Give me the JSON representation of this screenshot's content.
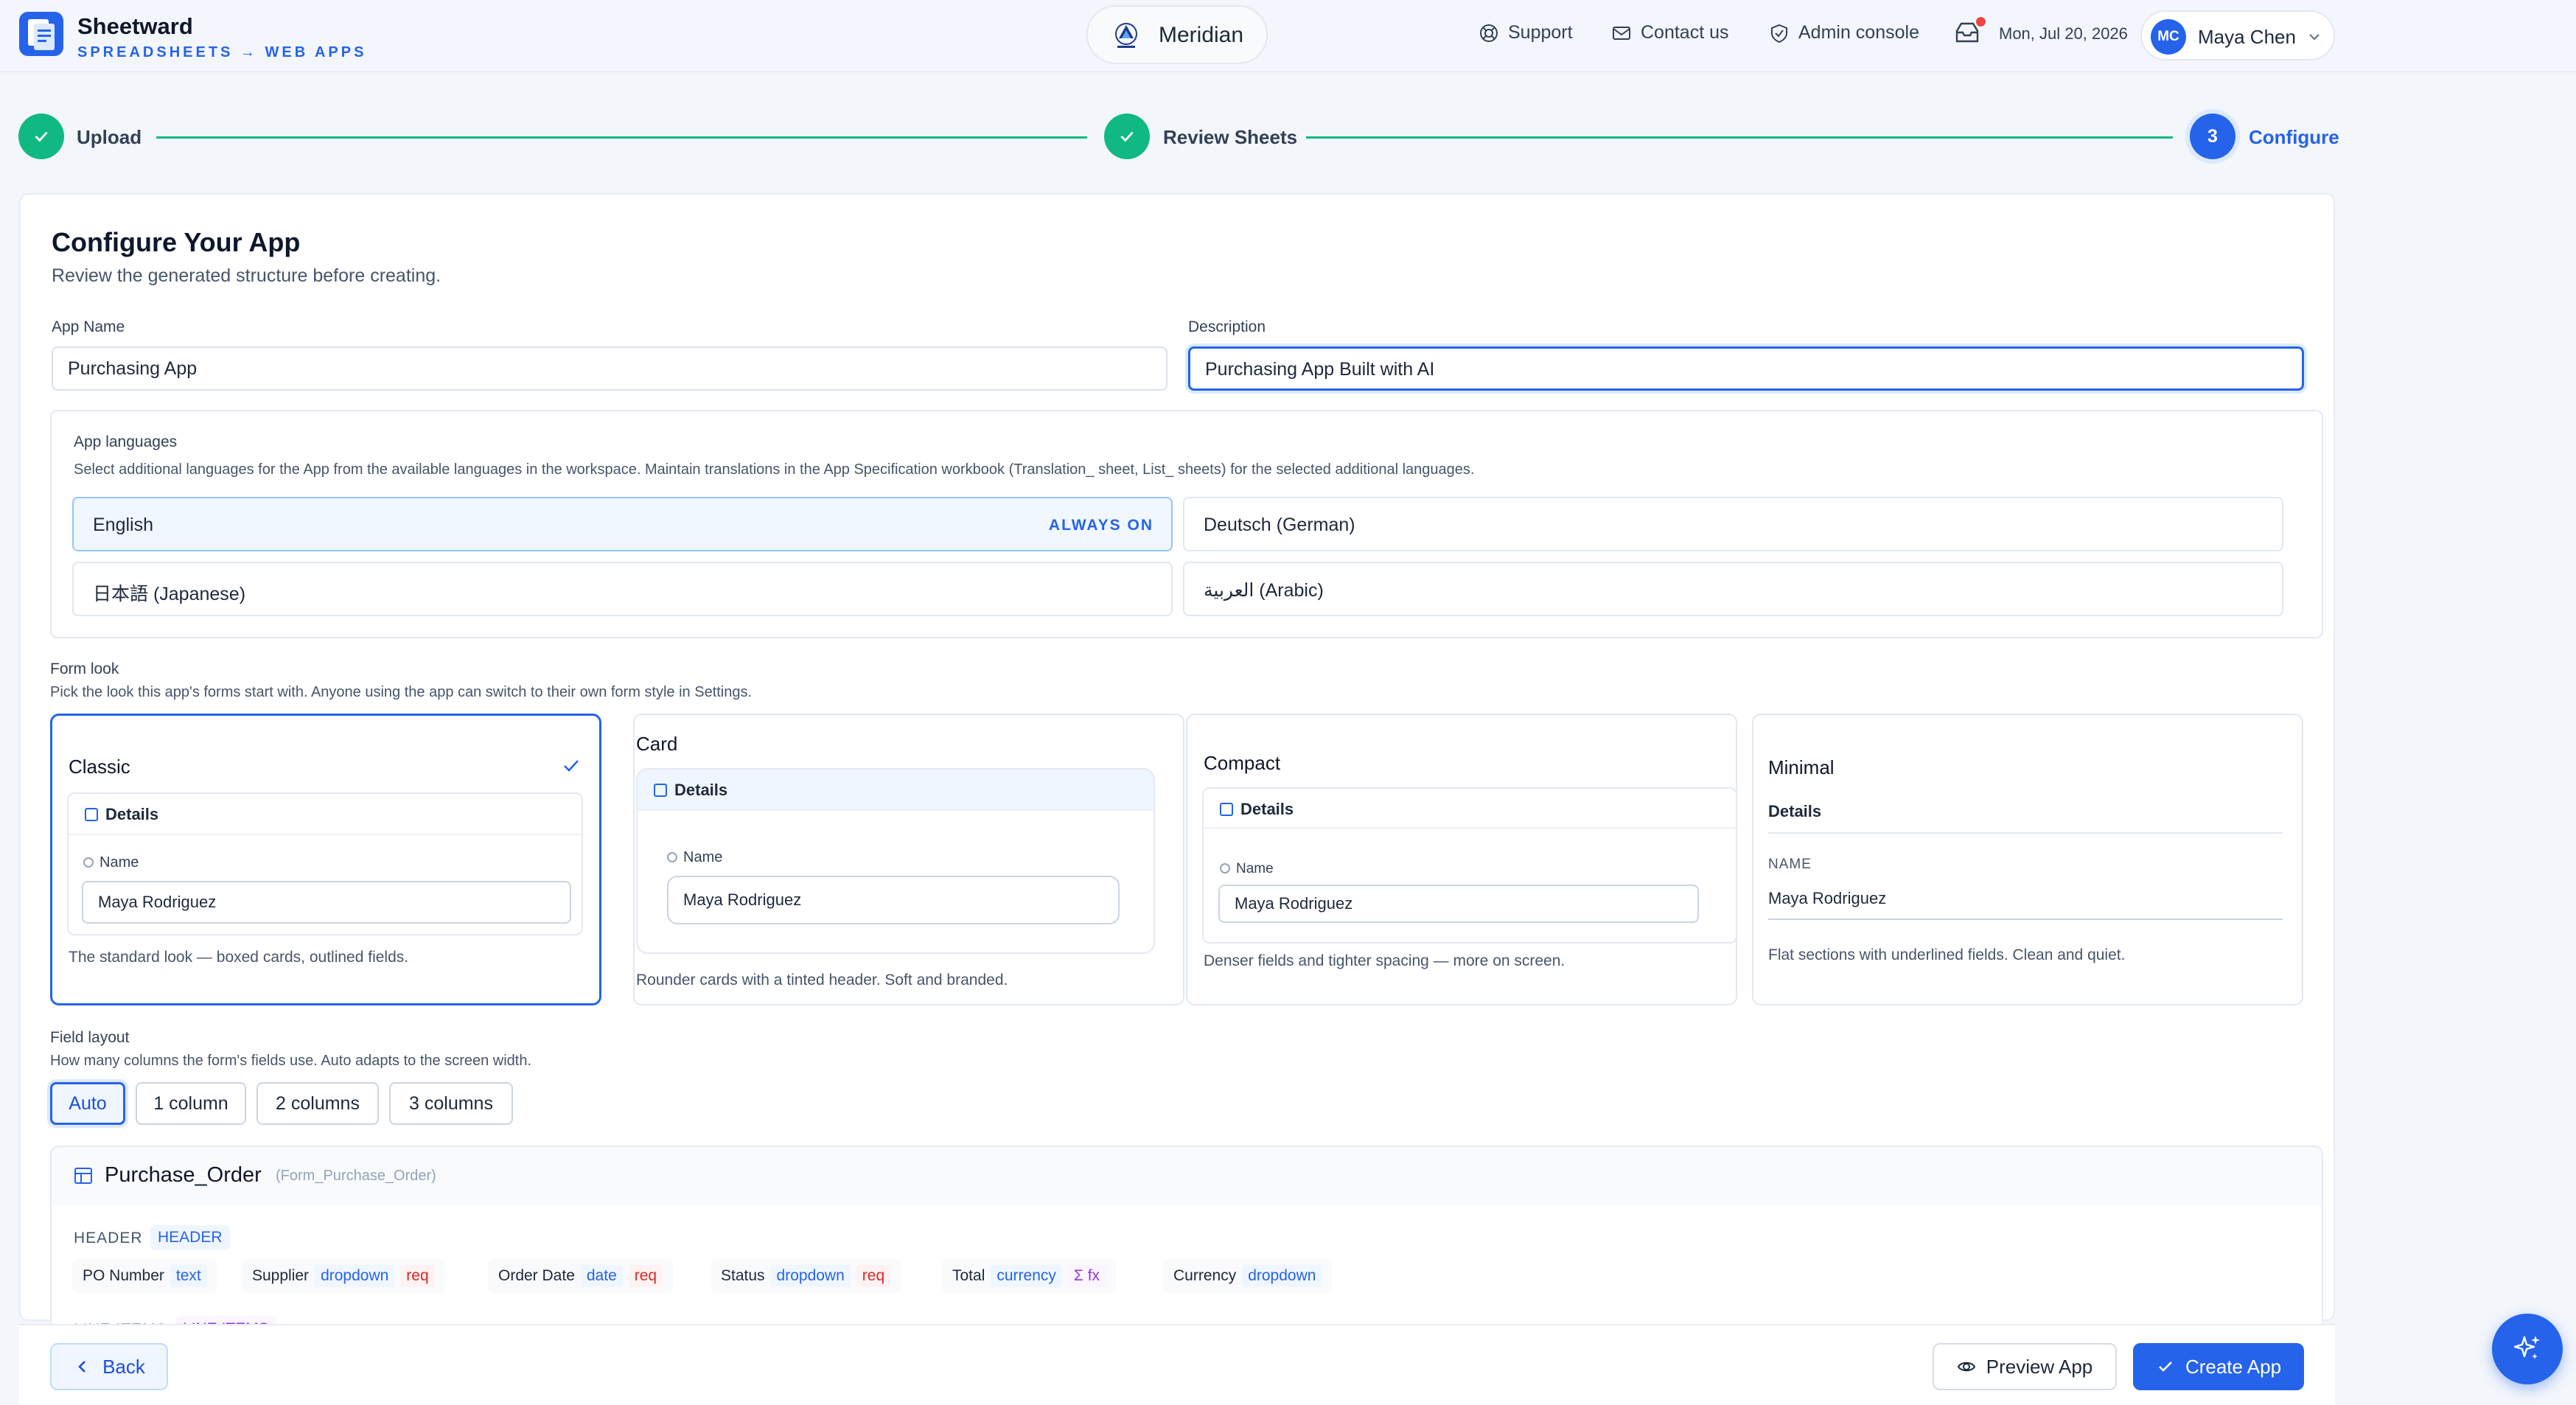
{
  "app": {
    "brand": "Sheetward",
    "tagline": "SPREADSHEETS → WEB APPS",
    "workspace": "Meridian"
  },
  "header": {
    "support": "Support",
    "contact": "Contact us",
    "admin": "Admin console",
    "date": "Mon, Jul 20, 2026",
    "user_initials": "MC",
    "user_name": "Maya Chen"
  },
  "stepper": {
    "steps": [
      {
        "label": "Upload",
        "state": "done"
      },
      {
        "label": "Review Sheets",
        "state": "done"
      },
      {
        "label": "Configure",
        "number": "3",
        "state": "current"
      }
    ]
  },
  "config": {
    "title": "Configure Your App",
    "subtitle": "Review the generated structure before creating.",
    "app_name_label": "App Name",
    "app_name_value": "Purchasing App",
    "description_label": "Description",
    "description_value": "Purchasing App Built with AI"
  },
  "languages": {
    "title": "App languages",
    "hint": "Select additional languages for the App from the available languages in the workspace. Maintain translations in the App Specification workbook (Translation_ sheet, List_ sheets) for the selected additional languages.",
    "items": [
      {
        "label": "English",
        "badge": "ALWAYS ON",
        "selected": true
      },
      {
        "label": "Deutsch (German)",
        "selected": false
      },
      {
        "label": "日本語 (Japanese)",
        "selected": false
      },
      {
        "label": "العربية (Arabic)",
        "selected": false
      }
    ]
  },
  "form_look": {
    "title": "Form look",
    "hint": "Pick the look this app's forms start with. Anyone using the app can switch to their own form style in Settings.",
    "options": [
      {
        "name": "Classic",
        "selected": true,
        "section": "Details",
        "field_label": "Name",
        "field_value": "Maya Rodriguez",
        "description": "The standard look — boxed cards, outlined fields."
      },
      {
        "name": "Card",
        "selected": false,
        "section": "Details",
        "field_label": "Name",
        "field_value": "Maya Rodriguez",
        "description": "Rounder cards with a tinted header. Soft and branded."
      },
      {
        "name": "Compact",
        "selected": false,
        "section": "Details",
        "field_label": "Name",
        "field_value": "Maya Rodriguez",
        "description": "Denser fields and tighter spacing — more on screen."
      },
      {
        "name": "Minimal",
        "selected": false,
        "section": "Details",
        "field_label": "NAME",
        "field_value": "Maya Rodriguez",
        "description": "Flat sections with underlined fields. Clean and quiet."
      }
    ]
  },
  "field_layout": {
    "title": "Field layout",
    "hint": "How many columns the form's fields use. Auto adapts to the screen width.",
    "options": [
      "Auto",
      "1 column",
      "2 columns",
      "3 columns"
    ],
    "selected": "Auto"
  },
  "entity": {
    "name": "Purchase_Order",
    "form_id": "(Form_Purchase_Order)",
    "section_label": "HEADER",
    "section_tag": "HEADER",
    "next_section": "LINE ITEMS",
    "fields": [
      {
        "name": "PO Number",
        "type": "text"
      },
      {
        "name": "Supplier",
        "type": "dropdown",
        "req": "req"
      },
      {
        "name": "Order Date",
        "type": "date",
        "req": "req"
      },
      {
        "name": "Status",
        "type": "dropdown",
        "req": "req"
      },
      {
        "name": "Total",
        "type": "currency",
        "fx": "Σ fx"
      },
      {
        "name": "Currency",
        "type": "dropdown"
      }
    ]
  },
  "actions": {
    "back": "Back",
    "preview": "Preview App",
    "create": "Create App"
  },
  "colors": {
    "primary": "#2563eb",
    "success": "#10b981",
    "required": "#dc2626",
    "formula": "#9333ea"
  }
}
